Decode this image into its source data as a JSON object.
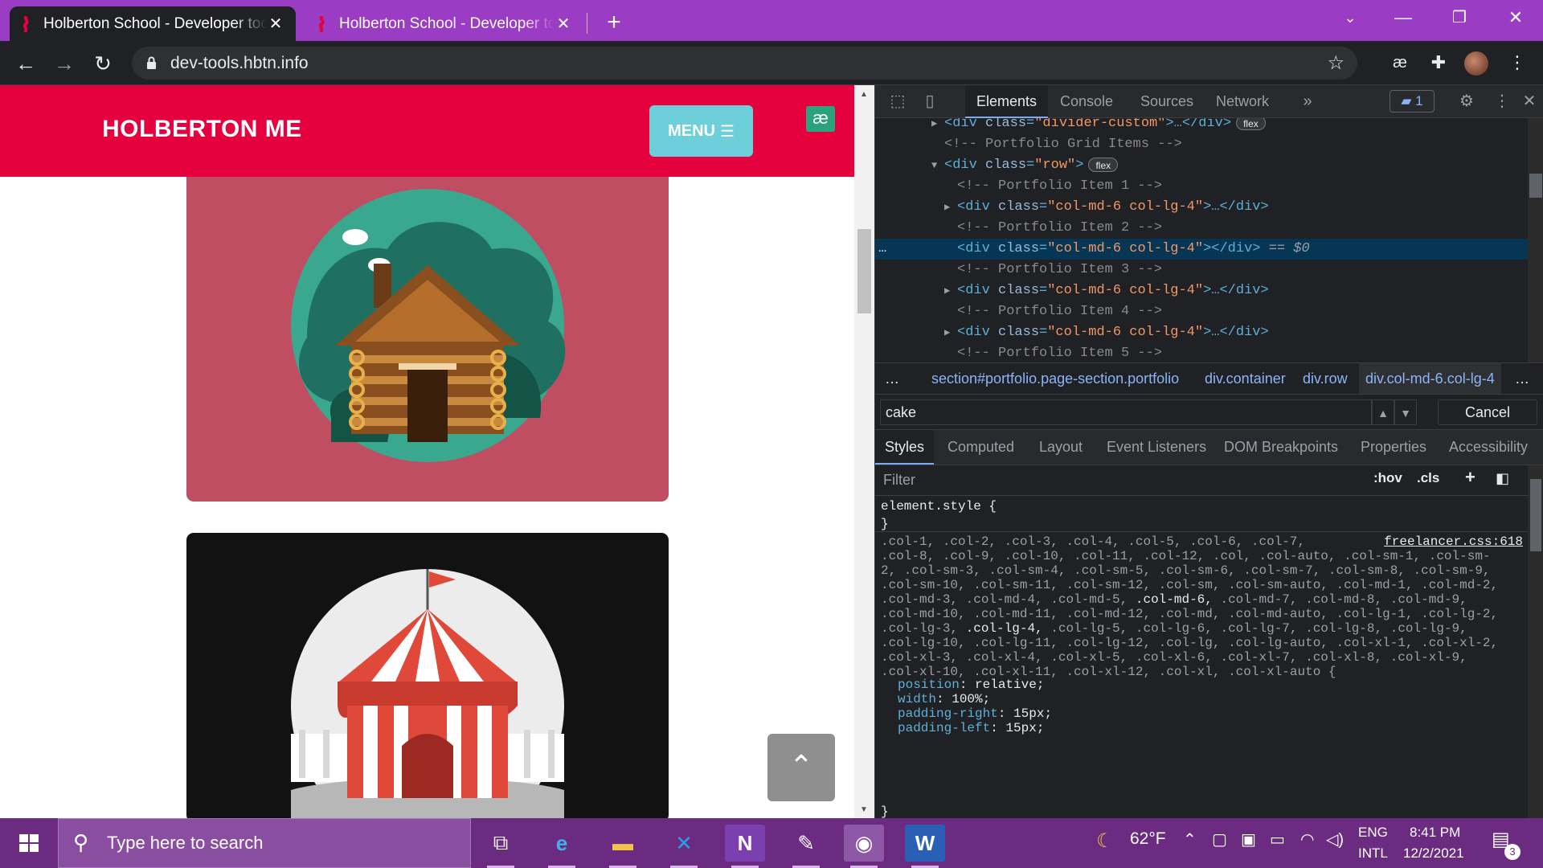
{
  "browser": {
    "tabs": [
      {
        "title": "Holberton School - Developer tools"
      },
      {
        "title": "Holberton School - Developer tools"
      }
    ],
    "url": "dev-tools.hbtn.info"
  },
  "site": {
    "brand": "HOLBERTON ME",
    "menu_label": "MENU",
    "badge": "æ"
  },
  "devtools": {
    "tabs": [
      "Elements",
      "Console",
      "Sources",
      "Network"
    ],
    "issues_count": "1",
    "dom_lines": [
      {
        "type": "el",
        "tri": "▶",
        "indent": 4,
        "tag": "div",
        "cls": "divider-custom",
        "tail": "…</div>",
        "badge": "flex"
      },
      {
        "type": "cmt",
        "indent": 4,
        "text": "<!-- Portfolio Grid Items -->"
      },
      {
        "type": "el",
        "tri": "▼",
        "indent": 4,
        "tag": "div",
        "cls": "row",
        "tail": "",
        "badge": "flex"
      },
      {
        "type": "cmt",
        "indent": 5,
        "text": "<!-- Portfolio Item 1 -->"
      },
      {
        "type": "el",
        "tri": "▶",
        "indent": 5,
        "tag": "div",
        "cls": "col-md-6 col-lg-4",
        "tail": "…</div>",
        "badge": ""
      },
      {
        "type": "cmt",
        "indent": 5,
        "text": "<!-- Portfolio Item 2 -->"
      },
      {
        "type": "el",
        "tri": "",
        "indent": 5,
        "tag": "div",
        "cls": "col-md-6 col-lg-4",
        "tail": "</div>",
        "badge": "",
        "selected": true,
        "suffix": "== $0"
      },
      {
        "type": "cmt",
        "indent": 5,
        "text": "<!-- Portfolio Item 3 -->"
      },
      {
        "type": "el",
        "tri": "▶",
        "indent": 5,
        "tag": "div",
        "cls": "col-md-6 col-lg-4",
        "tail": "…</div>",
        "badge": ""
      },
      {
        "type": "cmt",
        "indent": 5,
        "text": "<!-- Portfolio Item 4 -->"
      },
      {
        "type": "el",
        "tri": "▶",
        "indent": 5,
        "tag": "div",
        "cls": "col-md-6 col-lg-4",
        "tail": "…</div>",
        "badge": ""
      },
      {
        "type": "cmt",
        "indent": 5,
        "text": "<!-- Portfolio Item 5 -->"
      }
    ],
    "breadcrumbs": [
      {
        "text": "…"
      },
      {
        "text": "section#portfolio.page-section.portfolio"
      },
      {
        "text": "div.container"
      },
      {
        "text": "div.row"
      },
      {
        "text": "div.col-md-6.col-lg-4"
      }
    ],
    "search_value": "cake",
    "cancel_label": "Cancel",
    "sub_tabs": [
      "Styles",
      "Computed",
      "Layout",
      "Event Listeners",
      "DOM Breakpoints",
      "Properties",
      "Accessibility"
    ],
    "filter_placeholder": "Filter",
    "hov_label": ":hov",
    "cls_label": ".cls",
    "element_style": [
      "element.style {",
      "}"
    ],
    "rule_source": "freelancer.css:618",
    "selector_lines": [
      ".col-1, .col-2, .col-3, .col-4, .col-5, .col-6, .col-7,",
      ".col-8, .col-9, .col-10, .col-11, .col-12, .col, .col-auto, .col-sm-1, .col-sm-",
      "2, .col-sm-3, .col-sm-4, .col-sm-5, .col-sm-6, .col-sm-7, .col-sm-8, .col-sm-9,",
      ".col-sm-10, .col-sm-11, .col-sm-12, .col-sm, .col-sm-auto, .col-md-1, .col-md-2,",
      ".col-md-3, .col-md-4, .col-md-5, .col-md-6, .col-md-7, .col-md-8, .col-md-9,",
      ".col-md-10, .col-md-11, .col-md-12, .col-md, .col-md-auto, .col-lg-1, .col-lg-2,",
      ".col-lg-3, .col-lg-4, .col-lg-5, .col-lg-6, .col-lg-7, .col-lg-8, .col-lg-9,",
      ".col-lg-10, .col-lg-11, .col-lg-12, .col-lg, .col-lg-auto, .col-xl-1, .col-xl-2,",
      ".col-xl-3, .col-xl-4, .col-xl-5, .col-xl-6, .col-xl-7, .col-xl-8, .col-xl-9,",
      ".col-xl-10, .col-xl-11, .col-xl-12, .col-xl, .col-xl-auto {"
    ],
    "declarations": [
      {
        "prop": "position",
        "value": "relative;"
      },
      {
        "prop": "width",
        "value": "100%;"
      },
      {
        "prop": "padding-right",
        "value": "15px;"
      },
      {
        "prop": "padding-left",
        "value": "15px;"
      }
    ],
    "rule_close": "}"
  },
  "taskbar": {
    "search_placeholder": "Type here to search",
    "apps": [
      "task-view",
      "edge",
      "file-explorer",
      "vscode",
      "onenote",
      "snip-sketch",
      "chrome",
      "word"
    ],
    "weather": "62°F",
    "lang_top": "ENG",
    "lang_bottom": "INTL",
    "time": "8:41 PM",
    "date": "12/2/2021",
    "notifications": "3"
  }
}
